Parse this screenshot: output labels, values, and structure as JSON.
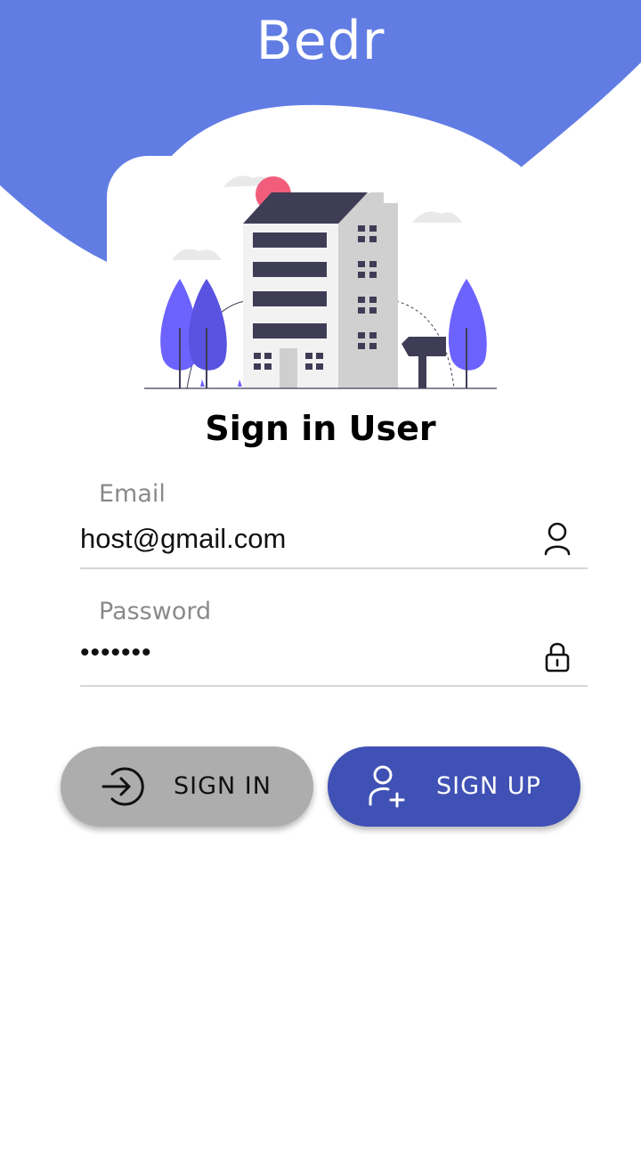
{
  "app": {
    "title": "Bedr"
  },
  "colors": {
    "header_blue": "#617de4",
    "primary_button": "#3f51b5",
    "secondary_button": "#adadad",
    "field_label": "#8a8a8a",
    "divider": "#d7d7d7"
  },
  "login": {
    "heading": "Sign in User",
    "email": {
      "label": "Email",
      "value": "host@gmail.com",
      "icon": "user-icon"
    },
    "password": {
      "label": "Password",
      "value": "•••••••",
      "icon": "lock-icon"
    }
  },
  "actions": {
    "sign_in_label": "SIGN IN",
    "sign_in_icon": "login-icon",
    "sign_up_label": "SIGN UP",
    "sign_up_icon": "add-user-icon"
  }
}
